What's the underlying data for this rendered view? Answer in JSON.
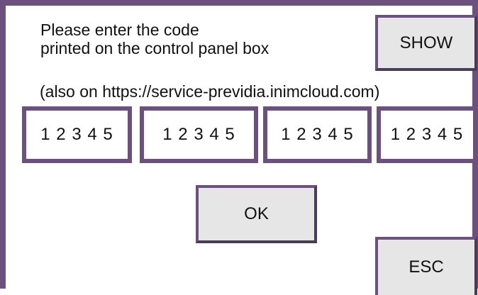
{
  "instructions": {
    "line1": "Please enter the code",
    "line2": "printed on the control panel box"
  },
  "url_note": "(also on https://service-previdia.inimcloud.com)",
  "buttons": {
    "show_label": "SHOW",
    "ok_label": "OK",
    "esc_label": "ESC"
  },
  "code_fields": [
    {
      "value": "1 2 3 4 5"
    },
    {
      "value": "1 2 3 4 5"
    },
    {
      "value": "1 2 3 4 5"
    },
    {
      "value": "1 2 3 4 5"
    }
  ],
  "colors": {
    "frame": "#6b5080",
    "button_bg": "#e6e6e6",
    "background": "#ffffff"
  }
}
